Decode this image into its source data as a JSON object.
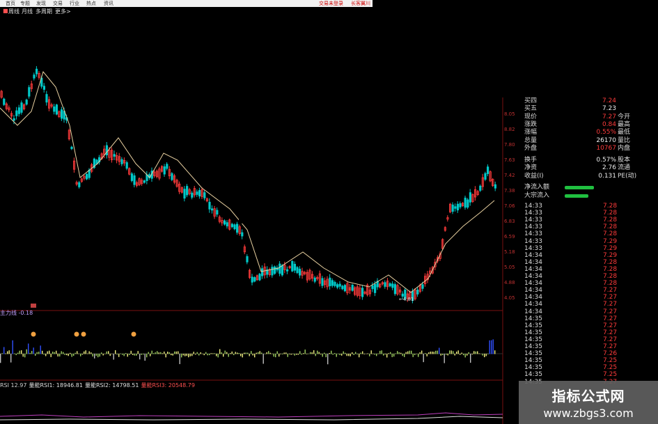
{
  "menu": {
    "items": [
      "首页",
      "专题",
      "发现",
      "交易",
      "行业",
      "热点",
      "资讯"
    ],
    "right_items": [
      "交易未登录",
      "长客翼川"
    ]
  },
  "tabs": [
    "周线",
    "月线",
    "多周期",
    "更多>"
  ],
  "chart": {
    "low_label": "4.81",
    "indicator_label": "主力线 -0.18",
    "indicator_value": "-0.18",
    "rsi_labels": [
      {
        "text": "RSI 12.97",
        "color": "#d0d0d0"
      },
      {
        "text": "量能RSI1: 18946.81",
        "color": "#e0e0e0"
      },
      {
        "text": "量能RSI2: 14798.51",
        "color": "#e0e0e0"
      },
      {
        "text": "量能RSI3: 20548.79",
        "color": "#ff5050"
      }
    ],
    "price_axis": [
      "8.05",
      "8.82",
      "7.80",
      "7.63",
      "7.42",
      "7.38",
      "7.06",
      "6.83",
      "6.59",
      "5.18",
      "5.05",
      "4.88",
      "4.05"
    ]
  },
  "quotes": {
    "rows": [
      {
        "label": "买四",
        "value": "7.24",
        "label2": "",
        "value_color": "#ff3b3b"
      },
      {
        "label": "买五",
        "value": "7.23",
        "label2": "",
        "value_color": "#eee"
      },
      {
        "label": "现价",
        "value": "7.27",
        "label2": "今开",
        "value_color": "#ff3b3b"
      },
      {
        "label": "涨跌",
        "value": "0.84",
        "label2": "最高",
        "value_color": "#ff3b3b"
      },
      {
        "label": "涨幅",
        "value": "0.55%",
        "label2": "最低",
        "value_color": "#ff3b3b"
      },
      {
        "label": "总量",
        "value": "26170",
        "label2": "量比",
        "value_color": "#eee"
      },
      {
        "label": "外盘",
        "value": "10767",
        "label2": "内盘",
        "value_color": "#ff3b3b"
      },
      {
        "label": "换手",
        "value": "0.57%",
        "label2": "股本",
        "value_color": "#eee"
      },
      {
        "label": "净资",
        "value": "2.76",
        "label2": "流通",
        "value_color": "#eee"
      },
      {
        "label": "收益(I)",
        "value": "0.131",
        "label2": "PE(动)",
        "value_color": "#eee"
      }
    ],
    "flows": [
      {
        "label": "净流入额",
        "fill": 0.75
      },
      {
        "label": "大宗流入",
        "fill": 0.6
      }
    ]
  },
  "trades": [
    {
      "time": "14:33",
      "price": "7.28"
    },
    {
      "time": "14:33",
      "price": "7.28"
    },
    {
      "time": "14:33",
      "price": "7.28"
    },
    {
      "time": "14:33",
      "price": "7.28"
    },
    {
      "time": "14:33",
      "price": "7.28"
    },
    {
      "time": "14:33",
      "price": "7.29"
    },
    {
      "time": "14:33",
      "price": "7.29"
    },
    {
      "time": "14:34",
      "price": "7.29"
    },
    {
      "time": "14:34",
      "price": "7.28"
    },
    {
      "time": "14:34",
      "price": "7.28"
    },
    {
      "time": "14:34",
      "price": "7.28"
    },
    {
      "time": "14:34",
      "price": "7.28"
    },
    {
      "time": "14:34",
      "price": "7.27"
    },
    {
      "time": "14:34",
      "price": "7.27"
    },
    {
      "time": "14:34",
      "price": "7.27"
    },
    {
      "time": "14:34",
      "price": "7.27"
    },
    {
      "time": "14:35",
      "price": "7.27"
    },
    {
      "time": "14:35",
      "price": "7.27"
    },
    {
      "time": "14:35",
      "price": "7.27"
    },
    {
      "time": "14:35",
      "price": "7.27"
    },
    {
      "time": "14:35",
      "price": "7.27"
    },
    {
      "time": "14:35",
      "price": "7.26"
    },
    {
      "time": "14:35",
      "price": "7.25"
    },
    {
      "time": "14:35",
      "price": "7.25"
    },
    {
      "time": "14:35",
      "price": "7.25"
    },
    {
      "time": "14:35",
      "price": "7.27"
    }
  ],
  "watermark": {
    "line1": "指标公式网",
    "line2": "www.zbgs3.com"
  },
  "colors": {
    "up": "#ff3b3b",
    "down": "#00c8c8",
    "ma": "#e8d0a0",
    "bg": "#000000",
    "flow": "#20c040"
  }
}
